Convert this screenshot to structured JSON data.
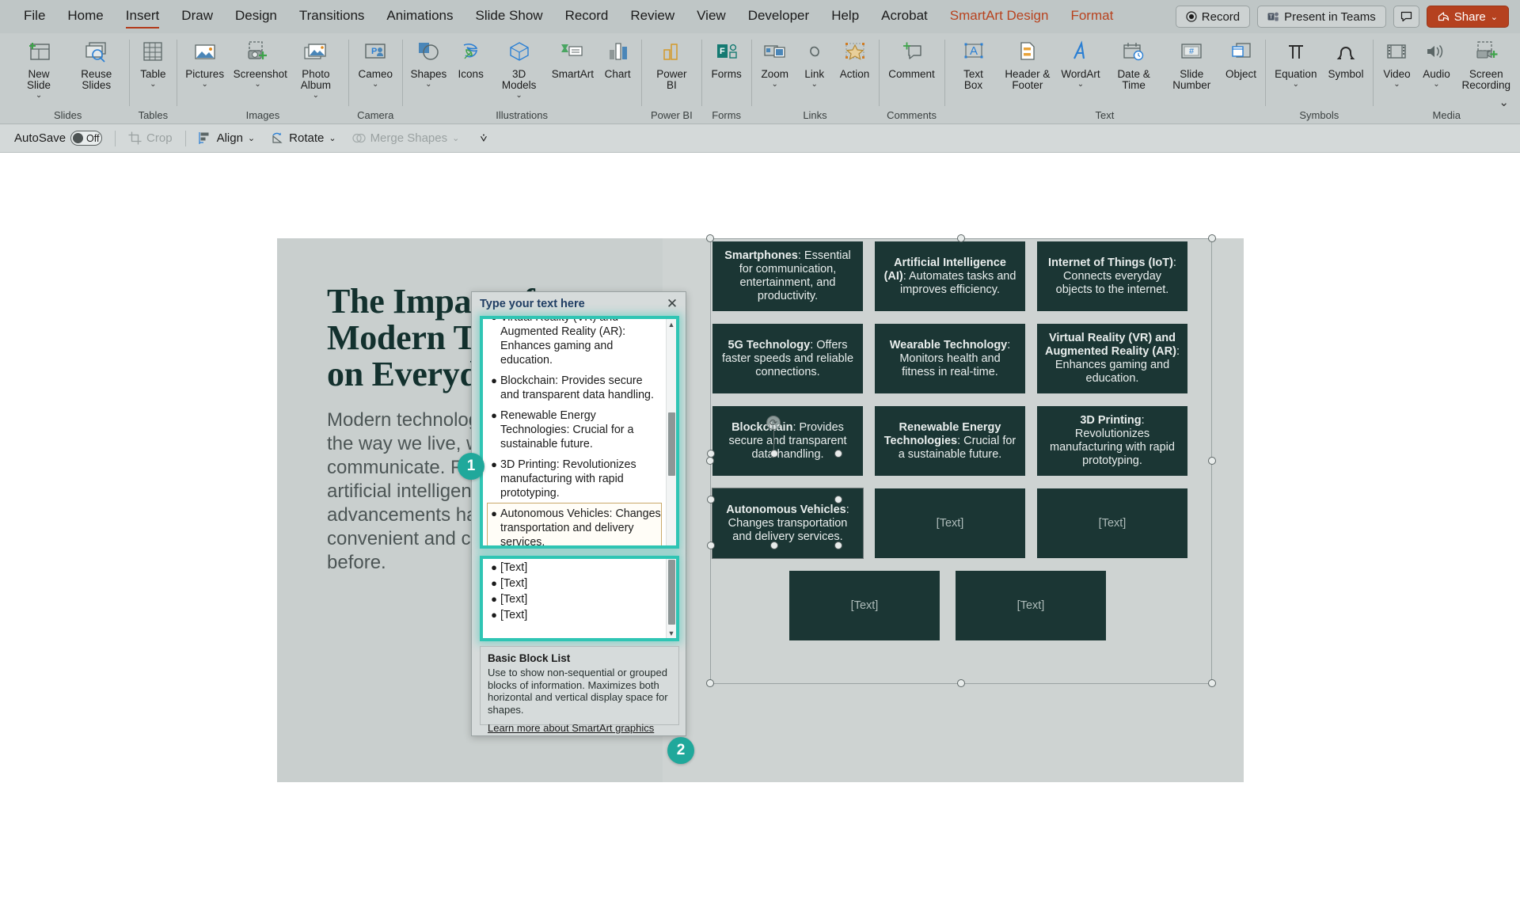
{
  "app": {
    "tabs": [
      {
        "label": "File",
        "active": false,
        "context": false
      },
      {
        "label": "Home",
        "active": false,
        "context": false
      },
      {
        "label": "Insert",
        "active": true,
        "context": false
      },
      {
        "label": "Draw",
        "active": false,
        "context": false
      },
      {
        "label": "Design",
        "active": false,
        "context": false
      },
      {
        "label": "Transitions",
        "active": false,
        "context": false
      },
      {
        "label": "Animations",
        "active": false,
        "context": false
      },
      {
        "label": "Slide Show",
        "active": false,
        "context": false
      },
      {
        "label": "Record",
        "active": false,
        "context": false
      },
      {
        "label": "Review",
        "active": false,
        "context": false
      },
      {
        "label": "View",
        "active": false,
        "context": false
      },
      {
        "label": "Developer",
        "active": false,
        "context": false
      },
      {
        "label": "Help",
        "active": false,
        "context": false
      },
      {
        "label": "Acrobat",
        "active": false,
        "context": false
      },
      {
        "label": "SmartArt Design",
        "active": false,
        "context": true
      },
      {
        "label": "Format",
        "active": false,
        "context": true
      }
    ],
    "titlebar_right": {
      "record": "Record",
      "present_in_teams": "Present in Teams",
      "comments_icon": "comment-icon",
      "share": "Share",
      "share_caret": "⌄"
    },
    "accent_color": "#b5411f",
    "teal_accent": "#20a89b"
  },
  "ribbon": {
    "groups": [
      {
        "name": "Slides",
        "items": [
          {
            "label": "New Slide",
            "icon": "new-slide-icon",
            "caret": true
          },
          {
            "label": "Reuse Slides",
            "icon": "reuse-slides-icon",
            "caret": false
          }
        ]
      },
      {
        "name": "Tables",
        "items": [
          {
            "label": "Table",
            "icon": "table-icon",
            "caret": true
          }
        ]
      },
      {
        "name": "Images",
        "items": [
          {
            "label": "Pictures",
            "icon": "pictures-icon",
            "caret": true
          },
          {
            "label": "Screenshot",
            "icon": "screenshot-icon",
            "caret": true
          },
          {
            "label": "Photo Album",
            "icon": "photo-album-icon",
            "caret": true
          }
        ]
      },
      {
        "name": "Camera",
        "items": [
          {
            "label": "Cameo",
            "icon": "cameo-icon",
            "caret": true
          }
        ]
      },
      {
        "name": "Illustrations",
        "items": [
          {
            "label": "Shapes",
            "icon": "shapes-icon",
            "caret": true
          },
          {
            "label": "Icons",
            "icon": "icons-icon",
            "caret": false
          },
          {
            "label": "3D Models",
            "icon": "3d-models-icon",
            "caret": true
          },
          {
            "label": "SmartArt",
            "icon": "smartart-icon",
            "caret": false
          },
          {
            "label": "Chart",
            "icon": "chart-icon",
            "caret": false
          }
        ]
      },
      {
        "name": "Power BI",
        "items": [
          {
            "label": "Power BI",
            "icon": "power-bi-icon",
            "caret": false
          }
        ]
      },
      {
        "name": "Forms",
        "items": [
          {
            "label": "Forms",
            "icon": "forms-icon",
            "caret": false
          }
        ]
      },
      {
        "name": "Links",
        "items": [
          {
            "label": "Zoom",
            "icon": "zoom-icon",
            "caret": true
          },
          {
            "label": "Link",
            "icon": "link-icon",
            "caret": true
          },
          {
            "label": "Action",
            "icon": "action-icon",
            "caret": false
          }
        ]
      },
      {
        "name": "Comments",
        "items": [
          {
            "label": "Comment",
            "icon": "comment-icon",
            "caret": false
          }
        ]
      },
      {
        "name": "Text",
        "items": [
          {
            "label": "Text Box",
            "icon": "text-box-icon",
            "caret": false
          },
          {
            "label": "Header & Footer",
            "icon": "header-footer-icon",
            "caret": false
          },
          {
            "label": "WordArt",
            "icon": "wordart-icon",
            "caret": true
          },
          {
            "label": "Date & Time",
            "icon": "date-time-icon",
            "caret": false
          },
          {
            "label": "Slide Number",
            "icon": "slide-number-icon",
            "caret": false
          },
          {
            "label": "Object",
            "icon": "object-icon",
            "caret": false
          }
        ]
      },
      {
        "name": "Symbols",
        "items": [
          {
            "label": "Equation",
            "icon": "equation-icon",
            "caret": true
          },
          {
            "label": "Symbol",
            "icon": "symbol-icon",
            "caret": false
          }
        ]
      },
      {
        "name": "Media",
        "items": [
          {
            "label": "Video",
            "icon": "video-icon",
            "caret": true
          },
          {
            "label": "Audio",
            "icon": "audio-icon",
            "caret": true
          },
          {
            "label": "Screen Recording",
            "icon": "screen-recording-icon",
            "caret": false
          }
        ]
      }
    ],
    "expand_caret": "⌄"
  },
  "quickbar": {
    "autosave_label": "AutoSave",
    "autosave_state": "Off",
    "crop": "Crop",
    "align": "Align",
    "rotate": "Rotate",
    "merge_shapes": "Merge Shapes",
    "caret": "⌄",
    "overflow": "⩒"
  },
  "slide": {
    "title": "The Impact of Modern Technology on Everyday Life",
    "body": "Modern technology has transformed the way we live, work, and communicate. From smartphones to artificial intelligence, these advancements have made life more convenient and connected than ever before."
  },
  "smartart": {
    "layout_name": "Basic Block List",
    "blocks": [
      {
        "bold": "Smartphones",
        "rest": ": Essential for communication, entertainment, and productivity.",
        "placeholder": false
      },
      {
        "bold": "Artificial Intelligence (AI)",
        "rest": ": Automates tasks and improves efficiency.",
        "placeholder": false
      },
      {
        "bold": "Internet of Things (IoT)",
        "rest": ": Connects everyday objects to the internet.",
        "placeholder": false
      },
      {
        "bold": "5G Technology",
        "rest": ": Offers faster speeds and reliable connections.",
        "placeholder": false
      },
      {
        "bold": "Wearable Technology",
        "rest": ": Monitors health and fitness in real-time.",
        "placeholder": false
      },
      {
        "bold": "Virtual Reality (VR) and Augmented Reality (AR)",
        "rest": ": Enhances gaming and education.",
        "placeholder": false
      },
      {
        "bold": "Blockchain",
        "rest": ": Provides secure and transparent data handling.",
        "placeholder": false
      },
      {
        "bold": "Renewable Energy Technologies",
        "rest": ": Crucial for a sustainable future.",
        "placeholder": false
      },
      {
        "bold": "3D Printing",
        "rest": ": Revolutionizes manufacturing with rapid prototyping.",
        "placeholder": false
      },
      {
        "bold": "Autonomous Vehicles",
        "rest": ": Changes transportation and delivery services.",
        "placeholder": false
      },
      {
        "bold": "",
        "rest": "[Text]",
        "placeholder": true
      },
      {
        "bold": "",
        "rest": "[Text]",
        "placeholder": true
      },
      {
        "bold": "",
        "rest": "[Text]",
        "placeholder": true
      },
      {
        "bold": "",
        "rest": "[Text]",
        "placeholder": true
      }
    ],
    "block_fill": "#1b3634",
    "block_text": "#e9eeed"
  },
  "textpane": {
    "title": "Type your text here",
    "close_icon": "close-icon",
    "scroll_up_icon": "▲",
    "scroll_down_icon": "▼",
    "items": [
      {
        "text": "Virtual Reality (VR) and Augmented Reality (AR): Enhances gaming and education.",
        "clipped": true,
        "active": false
      },
      {
        "text": "Blockchain: Provides secure and transparent data handling.",
        "clipped": false,
        "active": false
      },
      {
        "text": "Renewable Energy Technologies: Crucial for a sustainable future.",
        "clipped": false,
        "active": false
      },
      {
        "text": "3D Printing: Revolutionizes manufacturing with rapid prototyping.",
        "clipped": false,
        "active": false
      },
      {
        "text": "Autonomous Vehicles: Changes transportation and delivery services.",
        "clipped": false,
        "active": true
      }
    ],
    "placeholder_items": [
      "[Text]",
      "[Text]",
      "[Text]",
      "[Text]"
    ],
    "description": {
      "title": "Basic Block List",
      "body": "Use to show non-sequential or grouped blocks of information. Maximizes both horizontal and vertical display space for shapes.",
      "link": "Learn more about SmartArt graphics"
    }
  },
  "badges": [
    {
      "number": "1"
    },
    {
      "number": "2"
    }
  ]
}
